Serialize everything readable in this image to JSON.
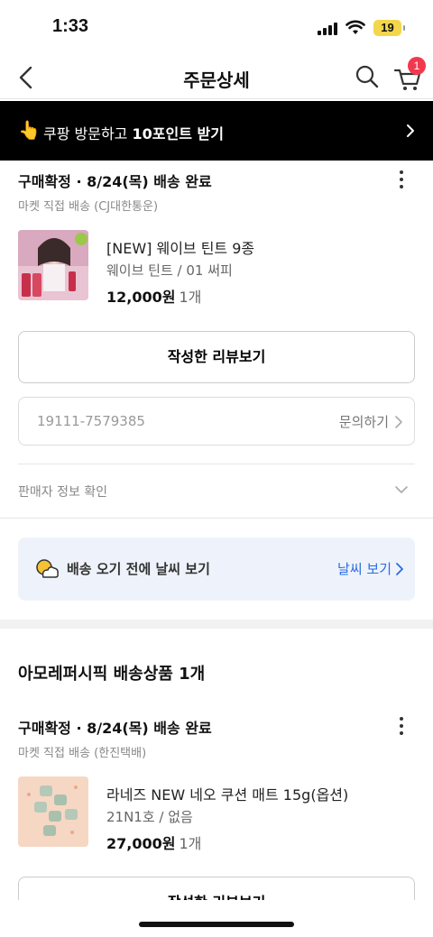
{
  "status": {
    "time": "1:33",
    "battery": "19"
  },
  "nav": {
    "title": "주문상세",
    "cart_count": "1"
  },
  "promo": {
    "emoji": "👆",
    "text_prefix": "쿠팡 방문하고 ",
    "text_bold": "10포인트 받기"
  },
  "order1": {
    "status": "구매확정 · 8/24(목) 배송 완료",
    "shipping": "마켓 직접 배송 (CJ대한통운)",
    "product_name": "[NEW] 웨이브 틴트 9종",
    "product_option": "웨이브 틴트 / 01 써피",
    "price": "12,000원",
    "qty": "1개",
    "review_button": "작성한 리뷰보기",
    "order_number": "19111-7579385",
    "inquiry": "문의하기",
    "seller_info": "판매자 정보 확인"
  },
  "weather": {
    "text": "배송 오기 전에 날씨 보기",
    "link": "날씨 보기"
  },
  "vendor": {
    "title": "아모레퍼시픽 배송상품 1개"
  },
  "order2": {
    "status": "구매확정 · 8/24(목) 배송 완료",
    "shipping": "마켓 직접 배송 (한진택배)",
    "product_name": "라네즈 NEW 네오 쿠션 매트 15g(옵션)",
    "product_option": "21N1호 / 없음",
    "price": "27,000원",
    "qty": "1개",
    "review_button": "작성한 리뷰보기"
  },
  "colors": {
    "accent_blue": "#2a6be0",
    "badge_red": "#f0394f",
    "promo_bg": "#000000"
  }
}
